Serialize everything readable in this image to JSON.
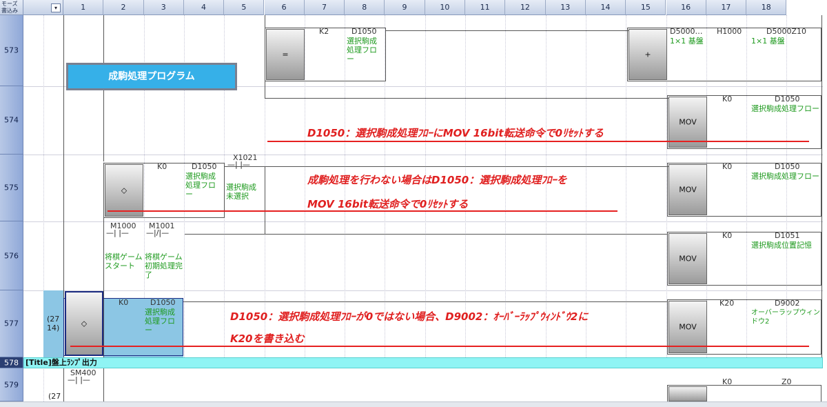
{
  "header": {
    "corner_label": "モーズ書込み",
    "filter_icon": "▾",
    "columns": [
      "1",
      "2",
      "3",
      "4",
      "5",
      "6",
      "7",
      "8",
      "9",
      "10",
      "11",
      "12",
      "13",
      "14",
      "15",
      "16",
      "17",
      "18"
    ]
  },
  "rows": [
    {
      "label": "573"
    },
    {
      "label": "574"
    },
    {
      "label": "575"
    },
    {
      "label": "576"
    },
    {
      "label": "577"
    },
    {
      "label": "578"
    },
    {
      "label": "579"
    }
  ],
  "title_box": "成駒処理プログラム",
  "r573": {
    "cmp_op": "=",
    "k2": "K2",
    "d1050": "D1050",
    "d1050_cmt": "選択駒成処理フロー",
    "add_op": "+",
    "d5000": "D5000…",
    "d5000_cmt": "1×1 基盤",
    "h1000": "H1000",
    "d5000z10": "D5000Z10",
    "d5000z10_cmt": "1×1 基盤"
  },
  "r574": {
    "mov": "MOV",
    "k0": "K0",
    "d1050": "D1050",
    "d1050_cmt": "選択駒成処理フロー",
    "annotation": "D1050：選択駒成処理ﾌﾛｰにMOV 16bit転送命令で0ﾘｾｯﾄする"
  },
  "r575": {
    "cmp_op": "◇",
    "k0": "K0",
    "d1050": "D1050",
    "d1050_cmt": "選択駒成処理フロー",
    "x1021": "X1021",
    "x1021_cmt": "選択駒成未選択",
    "mov": "MOV",
    "k0b": "K0",
    "d1050b": "D1050",
    "d1050b_cmt": "選択駒成処理フロー",
    "annotation1": "成駒処理を行わない場合はD1050：選択駒成処理ﾌﾛｰを",
    "annotation2": "MOV 16bit転送命令で0ﾘｾｯﾄする"
  },
  "r576": {
    "m1000": "M1000",
    "m1000_cmt": "将棋ゲームスタート",
    "m1001": "M1001",
    "m1001_cmt": "将棋ゲーム初期処理完了",
    "mov": "MOV",
    "k0": "K0",
    "d1051": "D1051",
    "d1051_cmt": "選択駒成位置記憶"
  },
  "r577": {
    "step": "(2714)",
    "cmp_op": "◇",
    "k0": "K0",
    "d1050": "D1050",
    "d1050_cmt": "選択駒成処理フロー",
    "mov": "MOV",
    "k20": "K20",
    "d9002": "D9002",
    "d9002_cmt": "オーバーラップウィンドウ2",
    "annotation1": "D1050：選択駒成処理ﾌﾛｰが0ではない場合、D9002：ｵｰﾊﾞｰﾗｯﾌﾟｳｨﾝﾄﾞｳ2に",
    "annotation2": "K20を書き込む"
  },
  "r578": {
    "title": "[Title]盤上ﾗﾝﾌﾟ出力"
  },
  "r579": {
    "step": "(27",
    "sm400": "SM400",
    "k0": "K0",
    "z0": "Z0",
    "mov": "MOV"
  }
}
